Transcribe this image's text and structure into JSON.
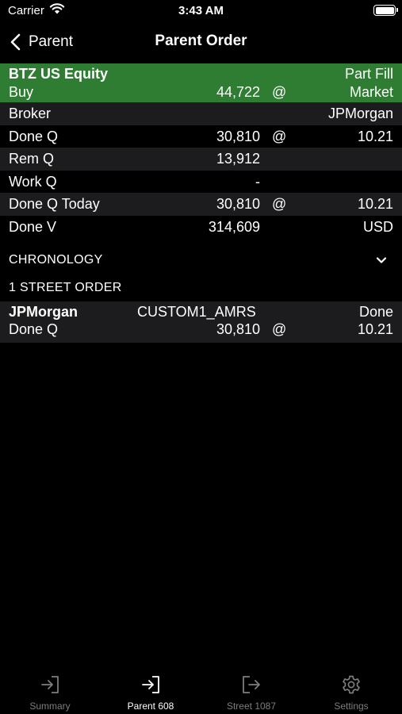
{
  "status_bar": {
    "carrier": "Carrier",
    "time": "3:43 AM"
  },
  "nav": {
    "back_label": "Parent",
    "title": "Parent Order"
  },
  "order": {
    "header": {
      "security": "BTZ US Equity",
      "status": "Part Fill",
      "side": "Buy",
      "quantity": "44,722",
      "at": "@",
      "price_type": "Market"
    },
    "rows": [
      {
        "label": "Broker",
        "qty": "",
        "at": "",
        "right": "JPMorgan"
      },
      {
        "label": "Done Q",
        "qty": "30,810",
        "at": "@",
        "right": "10.21"
      },
      {
        "label": "Rem Q",
        "qty": "13,912",
        "at": "",
        "right": ""
      },
      {
        "label": "Work Q",
        "qty": "-",
        "at": "",
        "right": ""
      },
      {
        "label": "Done Q Today",
        "qty": "30,810",
        "at": "@",
        "right": "10.21"
      },
      {
        "label": "Done V",
        "qty": "314,609",
        "at": "",
        "right": "USD"
      }
    ]
  },
  "chronology": {
    "label": "CHRONOLOGY"
  },
  "street_section": {
    "label": "1 STREET ORDER"
  },
  "street_orders": [
    {
      "broker": "JPMorgan",
      "strategy": "CUSTOM1_AMRS",
      "status": "Done",
      "done_label": "Done Q",
      "qty": "30,810",
      "at": "@",
      "price": "10.21"
    }
  ],
  "tabs": [
    {
      "label": "Summary",
      "icon": "login-arrow-icon",
      "active": false
    },
    {
      "label": "Parent 608",
      "icon": "login-arrow-icon",
      "active": true
    },
    {
      "label": "Street 1087",
      "icon": "logout-arrow-icon",
      "active": false
    },
    {
      "label": "Settings",
      "icon": "gear-icon",
      "active": false
    }
  ],
  "colors": {
    "header_green": "#2e7d32",
    "alt_row": "#1c1c1e",
    "inactive_tab": "#7d7d7d"
  }
}
